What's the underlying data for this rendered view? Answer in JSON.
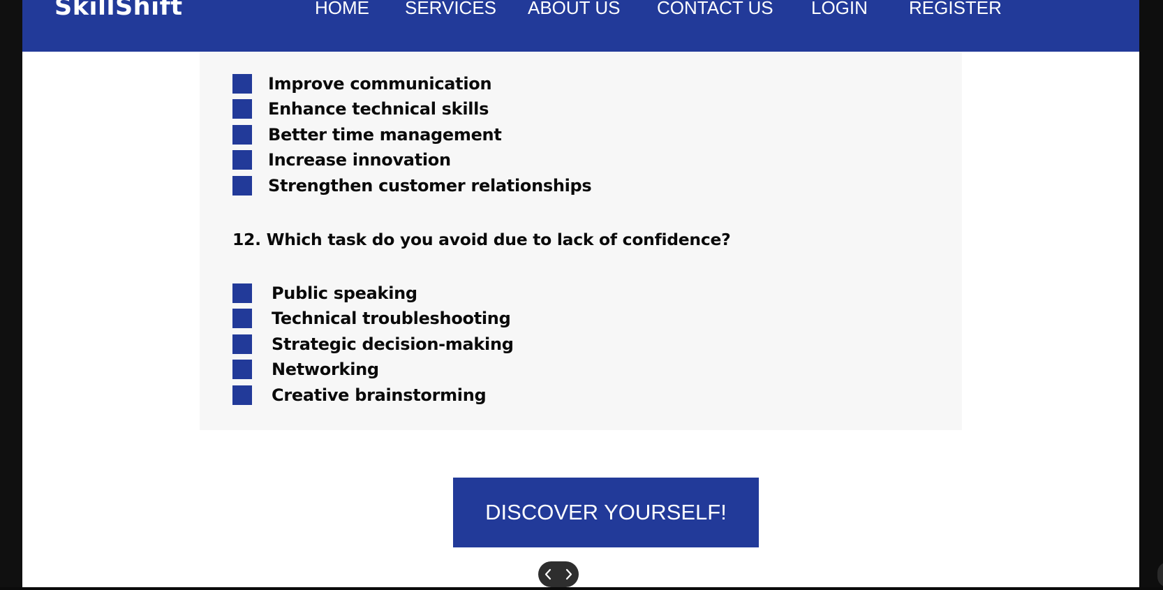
{
  "header": {
    "brand": "SkillShift",
    "nav": [
      "HOME",
      "SERVICES",
      "ABOUT US",
      "CONTACT US",
      "LOGIN",
      "REGISTER"
    ]
  },
  "question_prev": {
    "options": [
      "Improve communication",
      "Enhance technical skills",
      "Better time management",
      "Increase innovation",
      "Strengthen customer relationships"
    ]
  },
  "question_12": {
    "text": "12. Which task do you avoid due to lack of confidence?",
    "options": [
      "Public speaking",
      "Technical troubleshooting",
      "Strategic decision-making",
      "Networking",
      "Creative brainstorming"
    ]
  },
  "cta": {
    "label": "DISCOVER YOURSELF!"
  },
  "pager": {
    "prev_icon": "chevron-left-icon",
    "next_icon": "chevron-right-icon"
  },
  "colors": {
    "brand_blue": "#223a99",
    "panel_bg": "#f7f7f7",
    "text": "#0a0a0a"
  }
}
